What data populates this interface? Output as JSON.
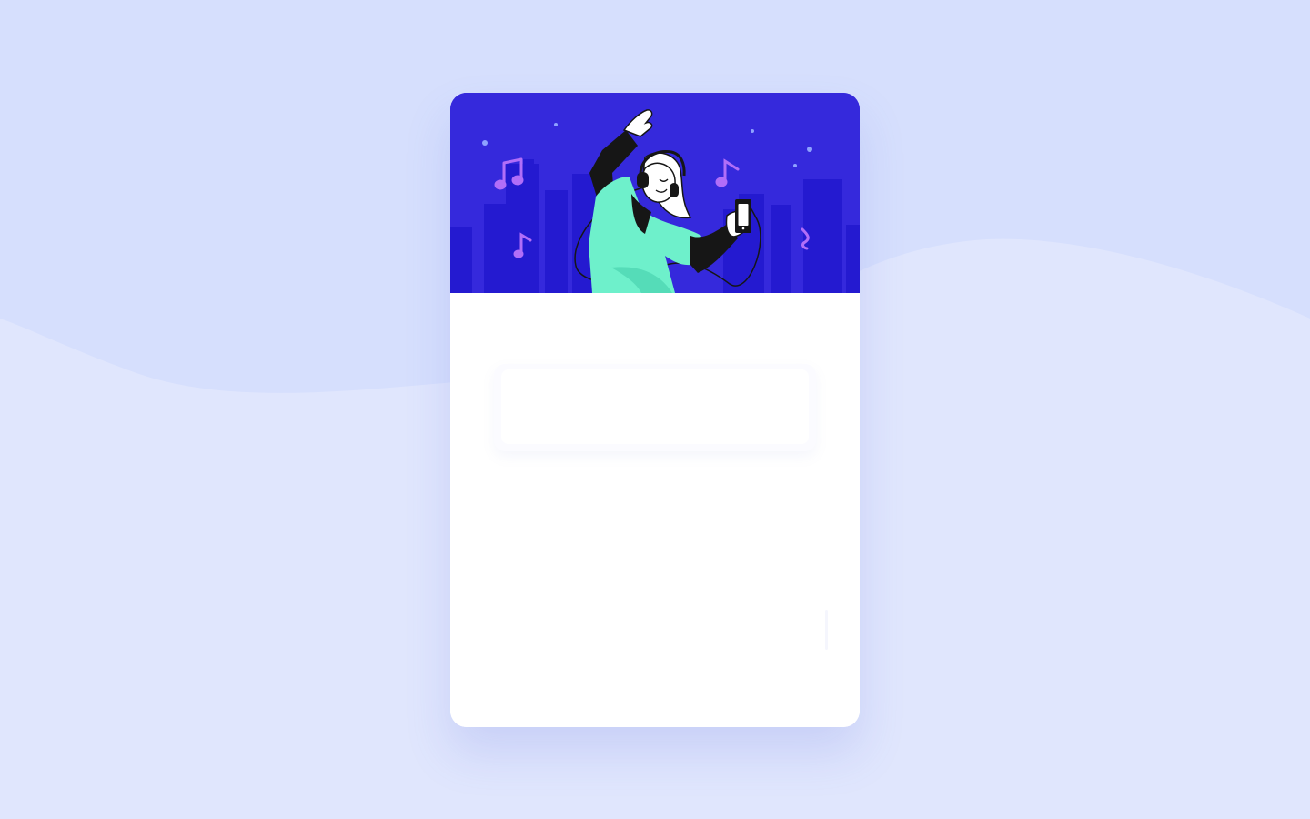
{
  "colors": {
    "page_background": "#e0e6fd",
    "wave_background": "#d6dffd",
    "card_background": "#ffffff",
    "hero_background": "#3529dc",
    "hero_buildings": "#241ad0",
    "figure_shirt": "#6ef0cb",
    "figure_dark": "#161616",
    "music_notes": "#b16ef8",
    "stars": "#8ea2ff"
  },
  "icons": {
    "hero_illustration": "music-listener-illustration",
    "music_note": "music-note-icon",
    "phone": "phone-icon",
    "headphones": "headphones-icon"
  }
}
